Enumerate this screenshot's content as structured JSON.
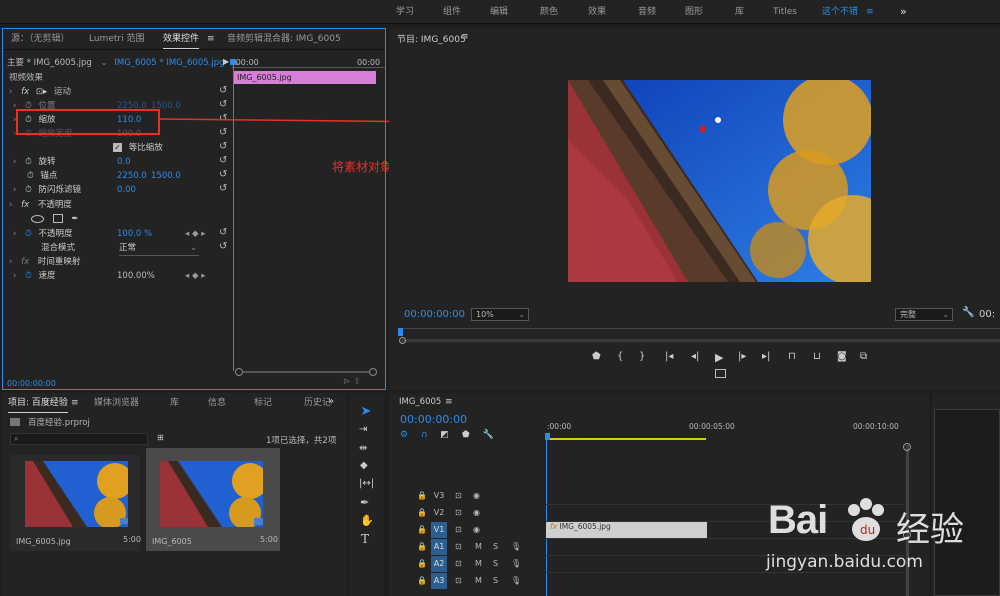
{
  "workspaces": [
    "学习",
    "组件",
    "编辑",
    "颜色",
    "效果",
    "音频",
    "图形",
    "库",
    "Titles",
    "这个不错"
  ],
  "workspace_menu_icon": "≡",
  "workspace_overflow": "»",
  "effect_controls": {
    "tabs": [
      "源：（无剪辑）",
      "Lumetri 范围",
      "效果控件",
      "音频剪辑混合器: IMG_6005"
    ],
    "master_clip": "主要 * IMG_6005.jpg",
    "sequence_clip": "IMG_6005 * IMG_6005.jpg",
    "ruler_start": ":00:00",
    "ruler_end": "00:00",
    "clip_bar_label": "IMG_6005.jpg",
    "section_video": "视频效果",
    "motion": "运动",
    "position_label": "位置",
    "position_x": "2250.0",
    "position_y": "1500.0",
    "scale_label": "缩放",
    "scale_value": "110.0",
    "scale_width_label": "缩放宽度",
    "scale_width_value": "100.0",
    "uniform_scale_label": "等比缩放",
    "rotation_label": "旋转",
    "rotation_value": "0.0",
    "anchor_label": "锚点",
    "anchor_x": "2250.0",
    "anchor_y": "1500.0",
    "antiflicker_label": "防闪烁滤镜",
    "antiflicker_value": "0.00",
    "opacity_section": "不透明度",
    "opacity_label": "不透明度",
    "opacity_value": "100.0 %",
    "blend_label": "混合模式",
    "blend_value": "正常",
    "time_remap_section": "时间重映射",
    "speed_label": "速度",
    "speed_value": "100.00%",
    "timecode": "00:00:00:00"
  },
  "annotation": {
    "text": "将素材对象放大一点",
    "color": "#e8302a"
  },
  "program_monitor": {
    "title": "节目: IMG_6005",
    "timecode": "00:00:00:00",
    "zoom": "10%",
    "quality": "完整",
    "timecode_right": "00:"
  },
  "project_panel": {
    "tabs": [
      "项目: 百度经验",
      "媒体浏览器",
      "库",
      "信息",
      "标记",
      "历史记"
    ],
    "project_file": "百度经验.prproj",
    "selection_info": "1项已选择，共2项",
    "items": [
      {
        "name": "IMG_6005.jpg",
        "duration": "5:00"
      },
      {
        "name": "IMG_6005",
        "duration": "5:00"
      }
    ]
  },
  "timeline": {
    "tab": "IMG_6005",
    "timecode": "00:00:00:00",
    "ruler": [
      ":00:00",
      "00:00:05:00",
      "00:00:10:00"
    ],
    "tracks": [
      "V3",
      "V2",
      "V1",
      "A1",
      "A2",
      "A3"
    ],
    "clip_label": "IMG_6005.jpg"
  },
  "watermark": {
    "line1": "Bai",
    "line2": "经验",
    "url": "jingyan.baidu.com"
  },
  "colors": {
    "accent": "#2d8ceb",
    "clip_pink": "#d77ed6",
    "annotation_red": "#e8302a",
    "panel": "#232323"
  }
}
